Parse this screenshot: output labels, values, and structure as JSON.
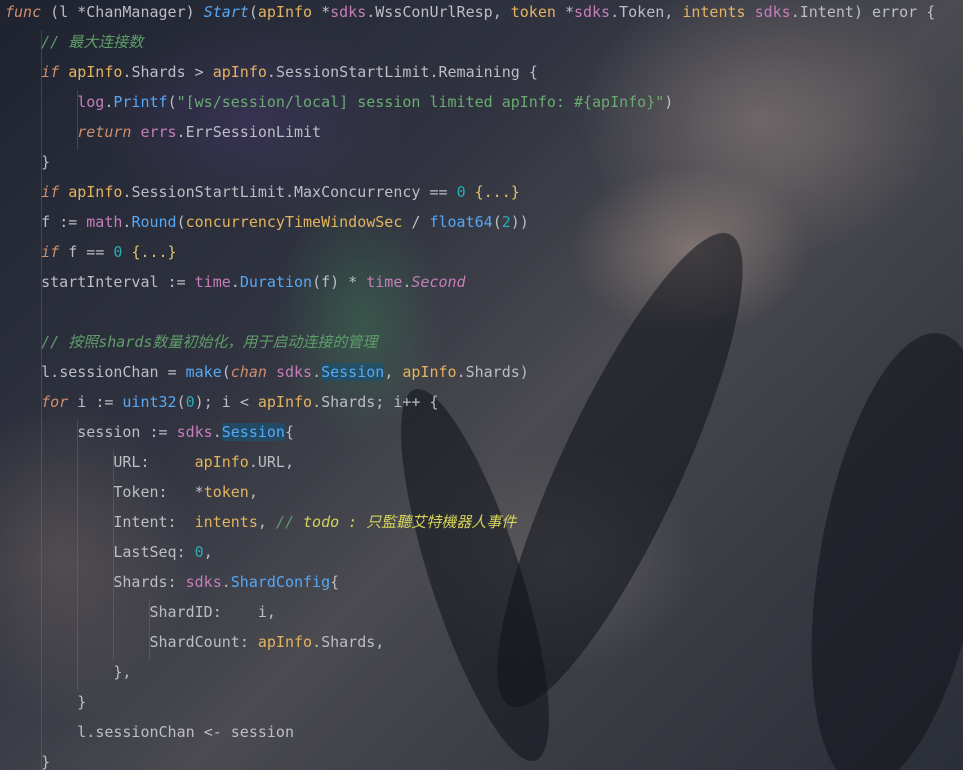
{
  "editor": {
    "lines": [
      "func (l *ChanManager) Start(apInfo *sdks.WssConUrlResp, token *sdks.Token, intents sdks.Intent) error {",
      "    // 最大连接数",
      "    if apInfo.Shards > apInfo.SessionStartLimit.Remaining {",
      "        log.Printf(\"[ws/session/local] session limited apInfo: #{apInfo}\")",
      "        return errs.ErrSessionLimit",
      "    }",
      "    if apInfo.SessionStartLimit.MaxConcurrency == 0 {...}",
      "    f := math.Round(concurrencyTimeWindowSec / float64(2))",
      "    if f == 0 {...}",
      "    startInterval := time.Duration(f) * time.Second",
      "",
      "    // 按照shards数量初始化，用于启动连接的管理",
      "    l.sessionChan = make(chan sdks.Session, apInfo.Shards)",
      "    for i := uint32(0); i < apInfo.Shards; i++ {",
      "        session := sdks.Session{",
      "            URL:     apInfo.URL,",
      "            Token:   *token,",
      "            Intent:  intents, // todo : 只監聽艾特機器人事件",
      "            LastSeq: 0,",
      "            Shards: sdks.ShardConfig{",
      "                ShardID:    i,",
      "                ShardCount: apInfo.Shards,",
      "            },",
      "        }",
      "        l.sessionChan <- session",
      "    }"
    ],
    "colors": {
      "keyword": "#cf8e6d",
      "function": "#56a8f5",
      "package": "#c77dbb",
      "number": "#2aacb8",
      "string": "#6aab73",
      "comment": "#7a7e85",
      "todo": "#d6d35a",
      "text": "#bcbec4"
    }
  }
}
